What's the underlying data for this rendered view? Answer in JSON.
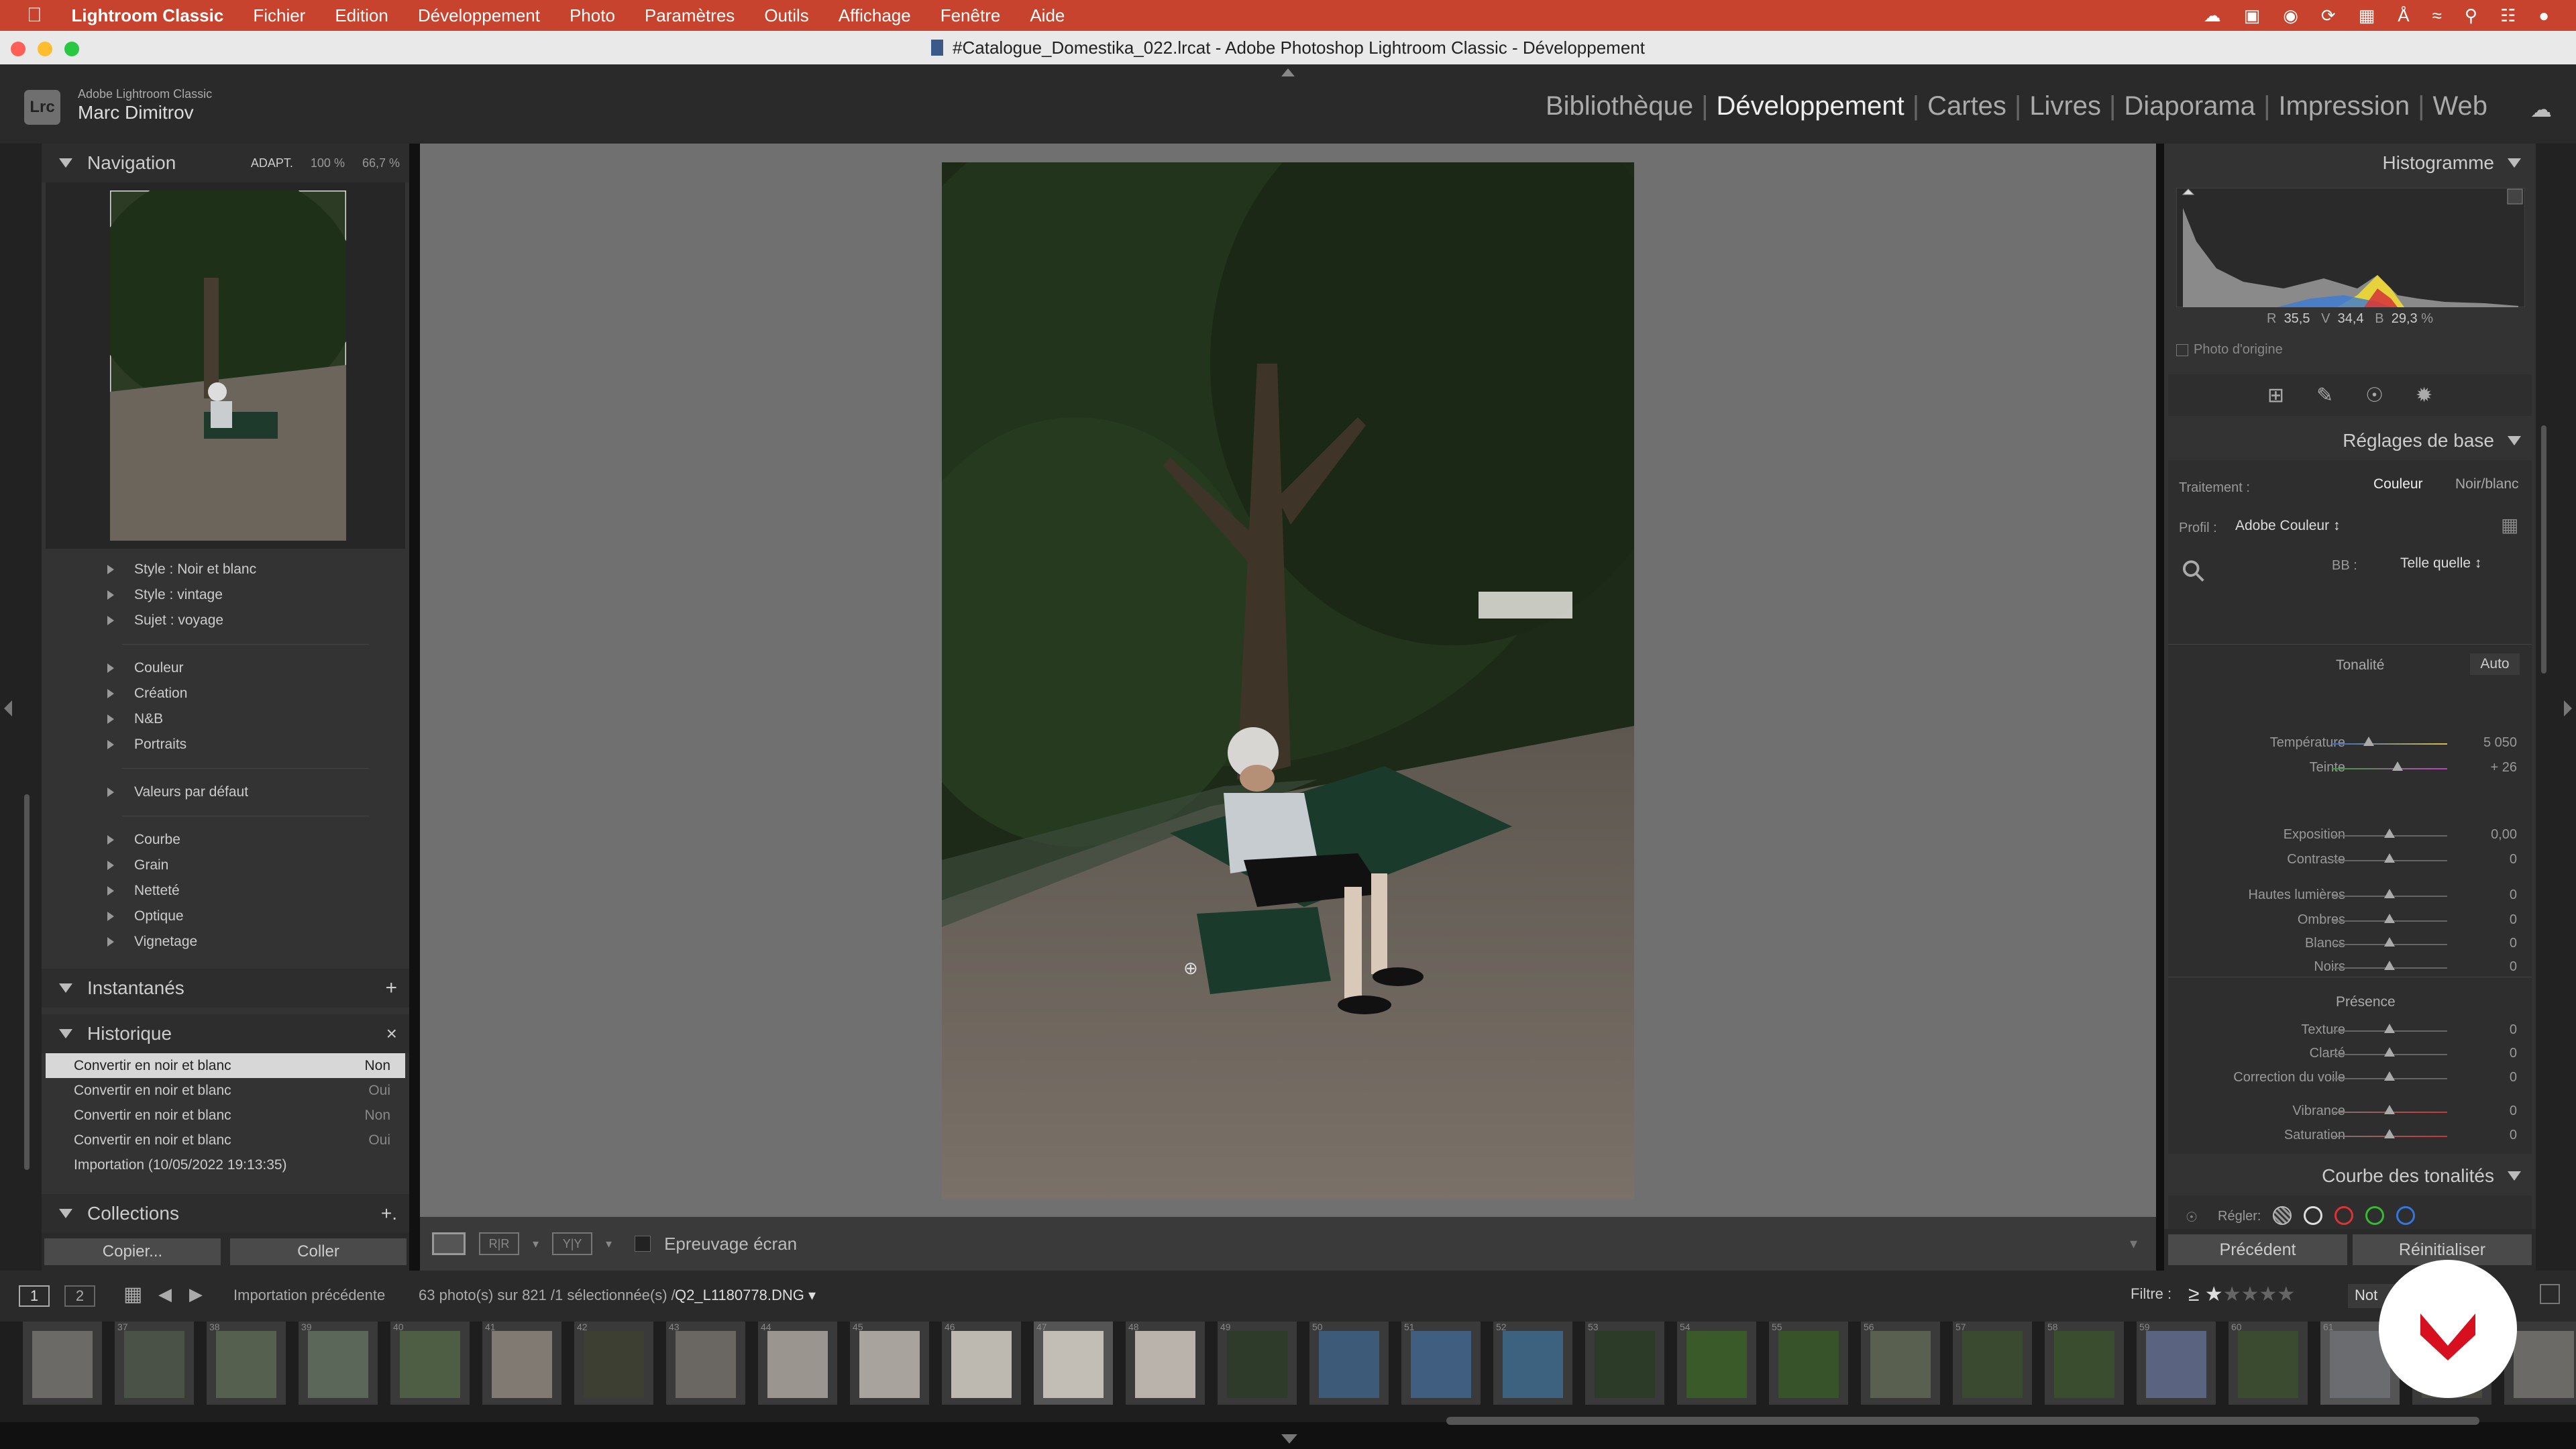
{
  "menubar": {
    "app": "Lightroom Classic",
    "items": [
      "Fichier",
      "Edition",
      "Développement",
      "Photo",
      "Paramètres",
      "Outils",
      "Affichage",
      "Fenêtre",
      "Aide"
    ]
  },
  "window": {
    "title": "#Catalogue_Domestika_022.lrcat - Adobe Photoshop Lightroom Classic - Développement"
  },
  "identity": {
    "logo": "Lrc",
    "product": "Adobe Lightroom Classic",
    "user": "Marc Dimitrov"
  },
  "modules": {
    "items": [
      "Bibliothèque",
      "Développement",
      "Cartes",
      "Livres",
      "Diaporama",
      "Impression",
      "Web"
    ],
    "active": "Développement"
  },
  "navigator": {
    "title": "Navigation",
    "zoom_fit": "ADAPT.",
    "zoom_100": "100 %",
    "zoom_custom": "66,7 %"
  },
  "presets": {
    "group1": [
      "Style : Noir et blanc",
      "Style : vintage",
      "Sujet : voyage"
    ],
    "group2": [
      "Couleur",
      "Création",
      "N&B",
      "Portraits"
    ],
    "group3": [
      "Valeurs par défaut"
    ],
    "group4": [
      "Courbe",
      "Grain",
      "Netteté",
      "Optique",
      "Vignetage"
    ]
  },
  "snapshots": {
    "title": "Instantanés",
    "add": "+"
  },
  "history": {
    "title": "Historique",
    "close": "×",
    "rows": [
      {
        "label": "Convertir en noir et blanc",
        "value": "Non"
      },
      {
        "label": "Convertir en noir et blanc",
        "value": "Oui"
      },
      {
        "label": "Convertir en noir et blanc",
        "value": "Non"
      },
      {
        "label": "Convertir en noir et blanc",
        "value": "Oui"
      },
      {
        "label": "Importation (10/05/2022 19:13:35)",
        "value": ""
      }
    ]
  },
  "collections": {
    "title": "Collections",
    "add": "+."
  },
  "left_buttons": {
    "copy": "Copier...",
    "paste": "Coller"
  },
  "toolbar": {
    "softproof": "Epreuvage écran"
  },
  "histogram": {
    "title": "Histogramme",
    "r_label": "R",
    "r_value": "35,5",
    "g_label": "V",
    "g_value": "34,4",
    "b_label": "B",
    "b_value": "29,3",
    "unit": "%",
    "original_photo": "Photo d'origine"
  },
  "basic": {
    "title": "Réglages de base",
    "treatment_label": "Traitement :",
    "treatment_color": "Couleur",
    "treatment_bw": "Noir/blanc",
    "profile_label": "Profil :",
    "profile_value": "Adobe Couleur",
    "wb_label": "BB :",
    "wb_value": "Telle quelle",
    "tone_label": "Tonalité",
    "auto": "Auto",
    "presence_label": "Présence",
    "sliders": [
      {
        "label": "Température",
        "value": "5 050",
        "pos": 0.32
      },
      {
        "label": "Teinte",
        "value": "+ 26",
        "pos": 0.57
      },
      {
        "label": "Exposition",
        "value": "0,00",
        "pos": 0.5
      },
      {
        "label": "Contraste",
        "value": "0",
        "pos": 0.5
      },
      {
        "label": "Hautes lumières",
        "value": "0",
        "pos": 0.5
      },
      {
        "label": "Ombres",
        "value": "0",
        "pos": 0.5
      },
      {
        "label": "Blancs",
        "value": "0",
        "pos": 0.5
      },
      {
        "label": "Noirs",
        "value": "0",
        "pos": 0.5
      },
      {
        "label": "Texture",
        "value": "0",
        "pos": 0.5
      },
      {
        "label": "Clarté",
        "value": "0",
        "pos": 0.5
      },
      {
        "label": "Correction du voile",
        "value": "0",
        "pos": 0.5
      },
      {
        "label": "Vibrance",
        "value": "0",
        "pos": 0.5
      },
      {
        "label": "Saturation",
        "value": "0",
        "pos": 0.5
      }
    ]
  },
  "curve": {
    "title": "Courbe des tonalités",
    "adjust_label": "Régler:"
  },
  "right_buttons": {
    "previous": "Précédent",
    "reset": "Réinitialiser"
  },
  "filmstrip": {
    "view1": "1",
    "view2": "2",
    "source": "Importation précédente",
    "count": "63 photo(s) sur 821 /1 sélectionnée(s) /",
    "filename": "Q2_L1180778.DNG",
    "filter_label": "Filtre :",
    "filter_value": "Not",
    "numbers": [
      "",
      "37",
      "38",
      "39",
      "40",
      "41",
      "42",
      "43",
      "44",
      "45",
      "46",
      "47",
      "48",
      "49",
      "50",
      "51",
      "52",
      "53",
      "54",
      "55",
      "56",
      "57",
      "58",
      "59",
      "60",
      "61",
      "62",
      ""
    ]
  },
  "colors": {
    "menubar": "#c8432d",
    "accent_badge": "#d6101f"
  }
}
